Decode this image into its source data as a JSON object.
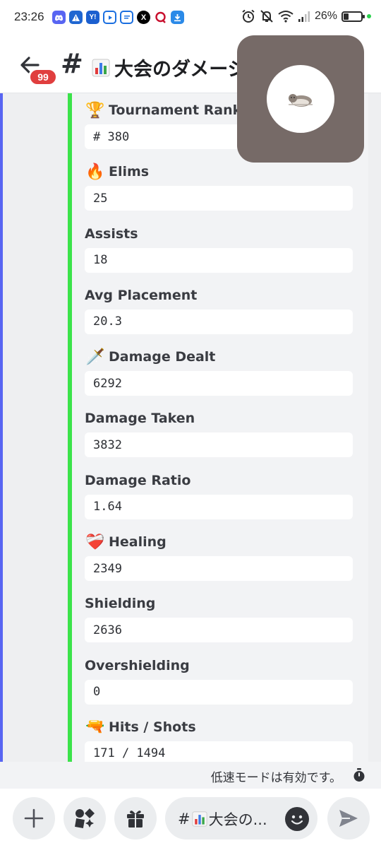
{
  "status_bar": {
    "time": "23:26",
    "battery_text": "26%",
    "battery_level": 0.26,
    "notification_icons": [
      "discord-icon",
      "alert-icon",
      "yahoo-icon",
      "youtube-icon",
      "news-icon",
      "x-icon",
      "chat-bubble-icon",
      "download-icon"
    ],
    "system_icons": [
      "alarm-icon",
      "mute-bell-icon",
      "wifi-icon",
      "signal-icon"
    ]
  },
  "header": {
    "unread_badge": "99",
    "hash": "#",
    "channel_name": "大会のダメージ",
    "channel_emoji": "bar-chart-icon"
  },
  "embed": {
    "accent_color": "#3be34a",
    "fields": [
      {
        "emoji": "🏆",
        "emoji_name": "trophy-icon",
        "name": "Tournament Rank",
        "value": "# 380"
      },
      {
        "emoji": "🔥",
        "emoji_name": "fire-icon",
        "name": "Elims",
        "value": "25"
      },
      {
        "emoji": "",
        "emoji_name": "",
        "name": "Assists",
        "value": "18"
      },
      {
        "emoji": "",
        "emoji_name": "",
        "name": "Avg Placement",
        "value": "20.3"
      },
      {
        "emoji": "🗡️",
        "emoji_name": "dagger-icon",
        "name": "Damage Dealt",
        "value": "6292"
      },
      {
        "emoji": "",
        "emoji_name": "",
        "name": "Damage Taken",
        "value": "3832"
      },
      {
        "emoji": "",
        "emoji_name": "",
        "name": "Damage Ratio",
        "value": "1.64"
      },
      {
        "emoji": "❤️‍🩹",
        "emoji_name": "mending-heart-icon",
        "name": "Healing",
        "value": "2349"
      },
      {
        "emoji": "",
        "emoji_name": "",
        "name": "Shielding",
        "value": "2636"
      },
      {
        "emoji": "",
        "emoji_name": "",
        "name": "Overshielding",
        "value": "0"
      },
      {
        "emoji": "🔫",
        "emoji_name": "water-pistol-icon",
        "name": "Hits / Shots",
        "value": "171 / 1494"
      }
    ]
  },
  "pip": {
    "avatar": "sleeping-animal-avatar"
  },
  "slow_mode": {
    "text": "低速モードは有効です。"
  },
  "composer": {
    "placeholder_prefix": "#",
    "placeholder_text": "大会の...",
    "buttons": [
      "add-button",
      "apps-button",
      "gift-button",
      "emoji-button",
      "send-button"
    ]
  }
}
